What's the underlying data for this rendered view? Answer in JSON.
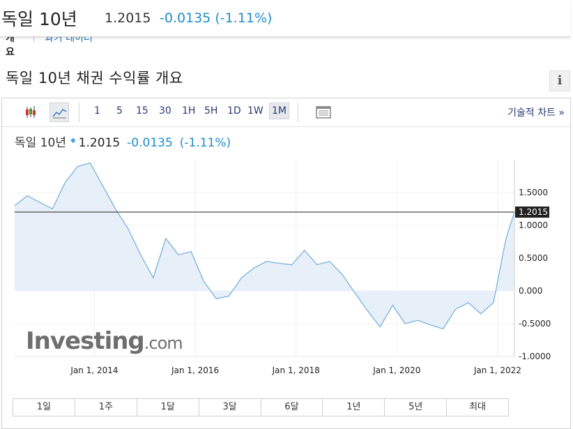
{
  "header": {
    "name": "독일 10년",
    "price": "1.2015",
    "change": "-0.0135 (-1.11%)"
  },
  "subtabs": {
    "overview": "개요",
    "historical": "과거 데이터"
  },
  "section": {
    "title": "독일 10년 채권 수익률 개요",
    "info_icon": "i"
  },
  "toolbar": {
    "icons": [
      "candlestick-icon",
      "area-chart-icon",
      "chart-table-icon"
    ],
    "ranges": [
      "1",
      "5",
      "15",
      "30",
      "1H",
      "5H",
      "1D",
      "1W",
      "1M"
    ],
    "selected_range": "1M",
    "advanced_label": "기술적 차트 »"
  },
  "legend": {
    "name": "독일 10년",
    "price": "1.2015",
    "change": "-0.0135",
    "change_pct": "(-1.11%)"
  },
  "chart_data": {
    "type": "area",
    "x": [
      "2012-06",
      "2012-09",
      "2012-12",
      "2013-03",
      "2013-06",
      "2013-09",
      "2013-12",
      "2014-03",
      "2014-06",
      "2014-09",
      "2014-12",
      "2015-03",
      "2015-06",
      "2015-09",
      "2015-12",
      "2016-03",
      "2016-06",
      "2016-09",
      "2016-12",
      "2017-03",
      "2017-06",
      "2017-09",
      "2017-12",
      "2018-03",
      "2018-06",
      "2018-09",
      "2018-12",
      "2019-03",
      "2019-06",
      "2019-09",
      "2019-12",
      "2020-03",
      "2020-06",
      "2020-09",
      "2020-12",
      "2021-03",
      "2021-06",
      "2021-09",
      "2021-12",
      "2022-03",
      "2022-05"
    ],
    "series": [
      {
        "values": [
          1.3,
          1.45,
          1.35,
          1.25,
          1.65,
          1.9,
          1.95,
          1.6,
          1.25,
          0.95,
          0.55,
          0.2,
          0.8,
          0.55,
          0.6,
          0.15,
          -0.12,
          -0.08,
          0.2,
          0.35,
          0.45,
          0.42,
          0.4,
          0.62,
          0.4,
          0.45,
          0.25,
          -0.03,
          -0.3,
          -0.55,
          -0.22,
          -0.5,
          -0.45,
          -0.52,
          -0.58,
          -0.28,
          -0.18,
          -0.35,
          -0.18,
          0.8,
          1.2
        ]
      }
    ],
    "ylim": [
      -1.0,
      2.0
    ],
    "yticks": [
      "1.5000",
      "1.0000",
      "0.5000",
      "0.000",
      "-0.5000",
      "-1.0000"
    ],
    "ytick_values": [
      1.5,
      1.0,
      0.5,
      0.0,
      -0.5,
      -1.0
    ],
    "xticks": [
      "Jan 1, 2014",
      "Jan 1, 2016",
      "Jan 1, 2018",
      "Jan 1, 2020",
      "Jan 1, 2022"
    ],
    "xtick_dates": [
      "2014-01",
      "2016-01",
      "2018-01",
      "2020-01",
      "2022-01"
    ],
    "current_value": 1.2015,
    "current_label": "1.2015",
    "grid": true,
    "colors": {
      "line": "#7ab1dc",
      "fill": "#e7f0f8",
      "current_line": "#222222",
      "label_bg": "#222222"
    }
  },
  "watermark": {
    "brand": "Investing",
    "suffix": ".com"
  },
  "periods": [
    "1일",
    "1주",
    "1달",
    "3달",
    "6달",
    "1년",
    "5년",
    "최대"
  ]
}
